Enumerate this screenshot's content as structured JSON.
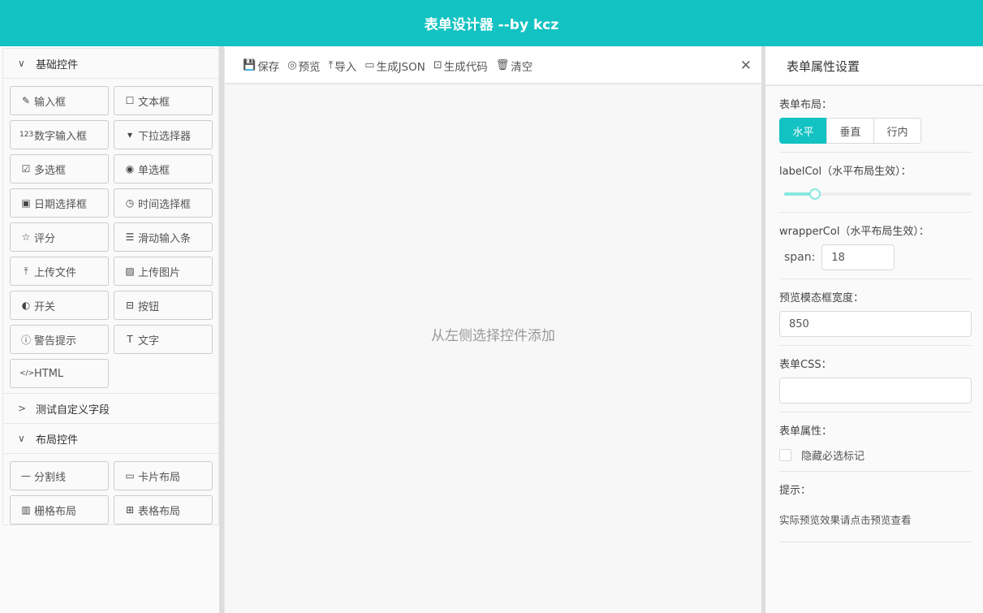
{
  "header": {
    "title": "表单设计器 --by kcz"
  },
  "sidebar": {
    "sections": [
      {
        "title": "基础控件",
        "expanded": true,
        "items": [
          {
            "label": "输入框",
            "icon": "✎"
          },
          {
            "label": "文本框",
            "icon": "☐"
          },
          {
            "label": "数字输入框",
            "icon": "123"
          },
          {
            "label": "下拉选择器",
            "icon": "▾"
          },
          {
            "label": "多选框",
            "icon": "☑"
          },
          {
            "label": "单选框",
            "icon": "◉"
          },
          {
            "label": "日期选择框",
            "icon": "▣"
          },
          {
            "label": "时间选择框",
            "icon": "◷"
          },
          {
            "label": "评分",
            "icon": "☆"
          },
          {
            "label": "滑动输入条",
            "icon": "☰"
          },
          {
            "label": "上传文件",
            "icon": "⤒"
          },
          {
            "label": "上传图片",
            "icon": "▨"
          },
          {
            "label": "开关",
            "icon": "◐"
          },
          {
            "label": "按钮",
            "icon": "⊟"
          },
          {
            "label": "警告提示",
            "icon": "ⓘ"
          },
          {
            "label": "文字",
            "icon": "T"
          },
          {
            "label": "HTML",
            "icon": "</>"
          }
        ]
      },
      {
        "title": "测试自定义字段",
        "expanded": false,
        "items": []
      },
      {
        "title": "布局控件",
        "expanded": true,
        "items": [
          {
            "label": "分割线",
            "icon": "—"
          },
          {
            "label": "卡片布局",
            "icon": "▭"
          },
          {
            "label": "栅格布局",
            "icon": "▥"
          },
          {
            "label": "表格布局",
            "icon": "⊞"
          }
        ]
      }
    ]
  },
  "toolbar": {
    "items": [
      {
        "label": "保存",
        "icon": "💾"
      },
      {
        "label": "预览",
        "icon": "◎"
      },
      {
        "label": "导入",
        "icon": "⤒"
      },
      {
        "label": "生成JSON",
        "icon": "▭"
      },
      {
        "label": "生成代码",
        "icon": "⊡"
      },
      {
        "label": "清空",
        "icon": "🗑"
      }
    ],
    "close": "✕"
  },
  "canvas": {
    "empty_text": "从左侧选择控件添加"
  },
  "props": {
    "title": "表单属性设置",
    "layout_label": "表单布局：",
    "layout_options": [
      "水平",
      "垂直",
      "行内"
    ],
    "layout_selected": 0,
    "labelcol_label": "labelCol（水平布局生效）：",
    "labelcol_value": 4,
    "labelcol_max": 24,
    "wrappercol_label": "wrapperCol（水平布局生效）：",
    "span_label": "span:",
    "span_value": "18",
    "preview_width_label": "预览模态框宽度：",
    "preview_width_value": "850",
    "css_label": "表单CSS：",
    "css_value": "",
    "attr_label": "表单属性：",
    "hide_required_label": "隐藏必选标记",
    "hide_required_checked": false,
    "tip_label": "提示：",
    "tip_text": "实际预览效果请点击预览查看"
  },
  "colors": {
    "accent": "#13c2c2",
    "slider": "#87e8de"
  }
}
